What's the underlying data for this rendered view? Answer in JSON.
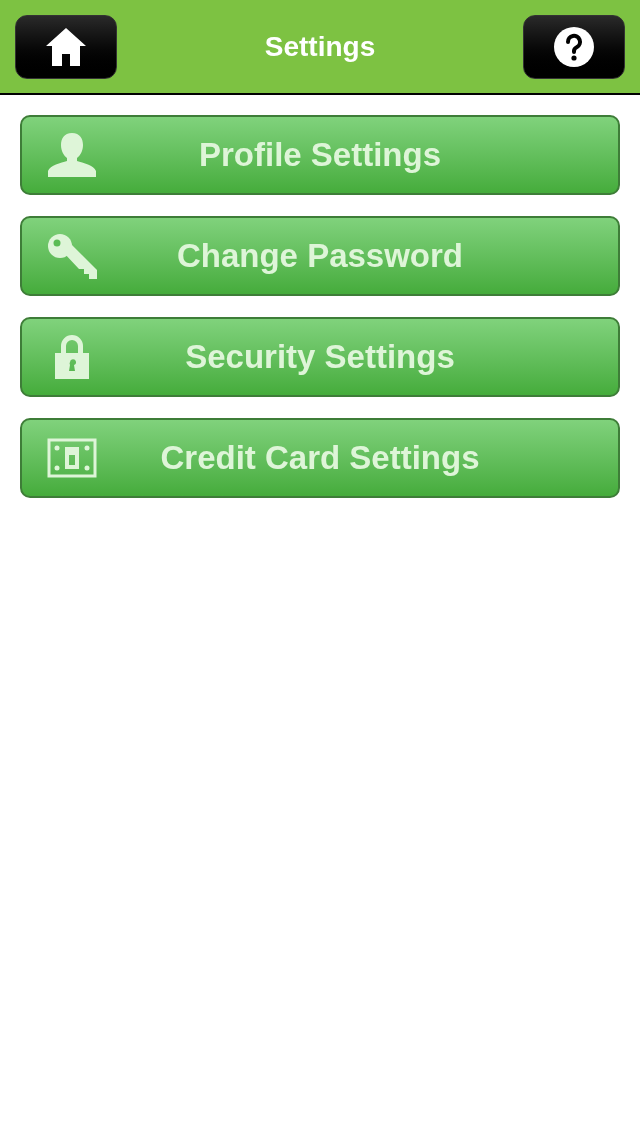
{
  "header": {
    "title": "Settings"
  },
  "items": [
    {
      "kind": "person",
      "label": "Profile Settings"
    },
    {
      "kind": "key",
      "label": "Change Password"
    },
    {
      "kind": "lock",
      "label": "Security Settings"
    },
    {
      "kind": "card",
      "label": "Credit Card Settings"
    }
  ]
}
